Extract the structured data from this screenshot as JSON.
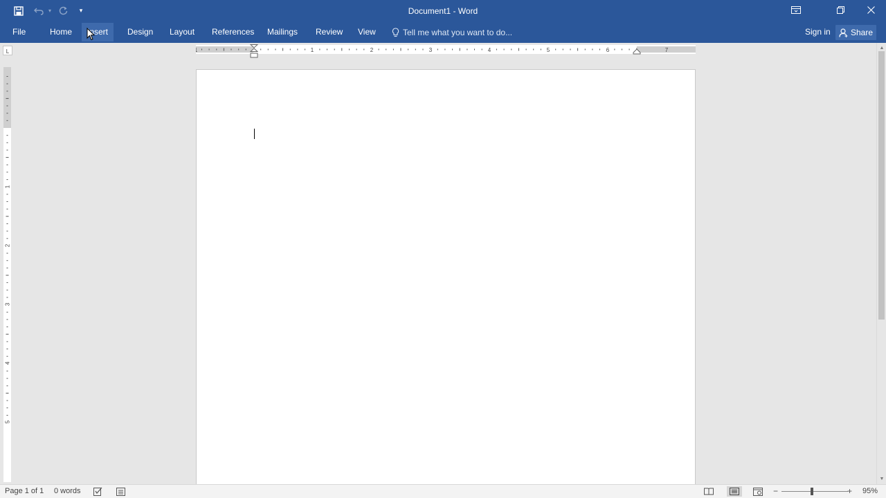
{
  "window": {
    "title": "Document1 - Word"
  },
  "qat": {
    "save_icon": "save-icon",
    "undo_icon": "undo-icon",
    "redo_icon": "redo-icon",
    "customize_icon": "chevron-down-icon",
    "customize_glyph": "▾"
  },
  "ribbon": {
    "tabs": [
      {
        "label": "File"
      },
      {
        "label": "Home"
      },
      {
        "label": "Insert"
      },
      {
        "label": "Design"
      },
      {
        "label": "Layout"
      },
      {
        "label": "References"
      },
      {
        "label": "Mailings"
      },
      {
        "label": "Review"
      },
      {
        "label": "View"
      }
    ],
    "tell_me_placeholder": "Tell me what you want to do...",
    "sign_in": "Sign in",
    "share": "Share"
  },
  "ruler": {
    "tab_selector_glyph": "L",
    "horizontal_numbers": [
      "1",
      "1",
      "2",
      "3",
      "4",
      "5",
      "6",
      "7"
    ],
    "vertical_numbers": [
      "1",
      "2",
      "3",
      "4",
      "5"
    ]
  },
  "statusbar": {
    "page_info": "Page 1 of 1",
    "word_count": "0 words",
    "zoom_minus": "−",
    "zoom_plus": "+",
    "zoom_level": "95%",
    "zoom_level_value": 95
  },
  "colors": {
    "brand_blue": "#2b579a",
    "tab_hover": "#3e6aac"
  }
}
